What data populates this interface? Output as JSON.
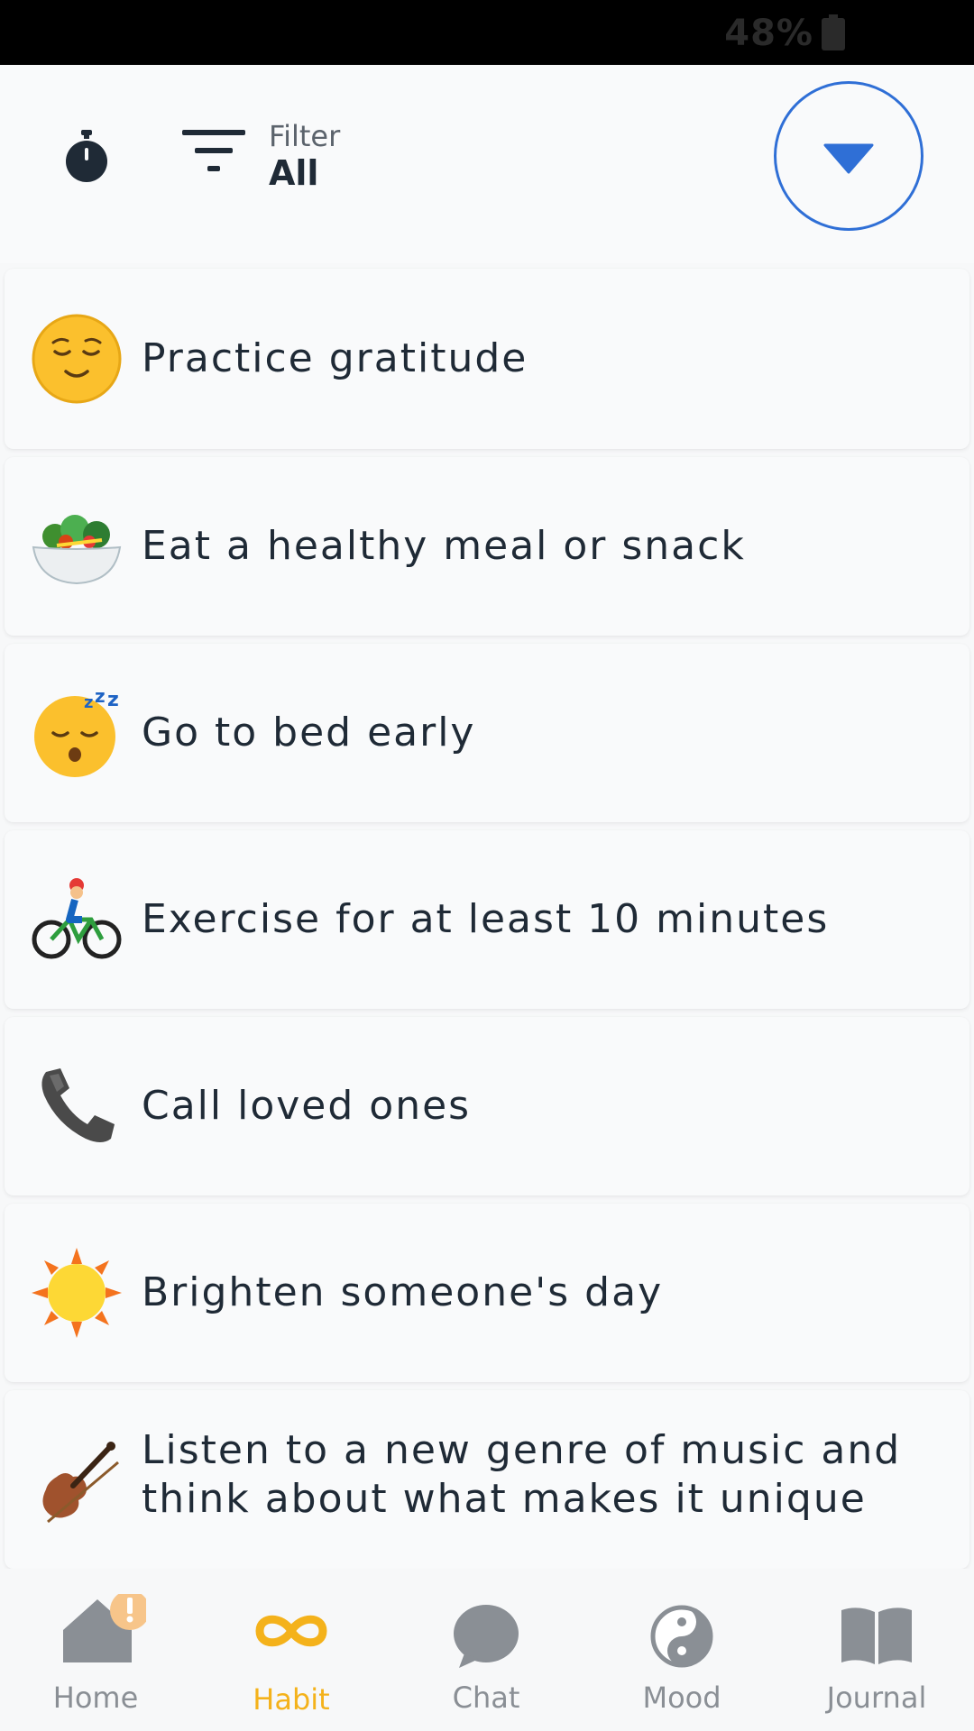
{
  "status_bar": {
    "battery": "48%"
  },
  "header": {
    "filter": {
      "label": "Filter",
      "value": "All"
    }
  },
  "habits": [
    {
      "emoji_icon": "relieved-face-icon",
      "label": "Practice gratitude"
    },
    {
      "emoji_icon": "salad-bowl-icon",
      "label": "Eat a healthy meal or snack"
    },
    {
      "emoji_icon": "sleeping-face-icon",
      "label": "Go to bed early"
    },
    {
      "emoji_icon": "person-biking-icon",
      "label": "Exercise for at least 10 minutes"
    },
    {
      "emoji_icon": "telephone-receiver-icon",
      "label": "Call loved ones"
    },
    {
      "emoji_icon": "sun-icon",
      "label": "Brighten someone's day"
    },
    {
      "emoji_icon": "violin-icon",
      "label": "Listen to a new genre of music and think about what makes it unique"
    }
  ],
  "tabs": [
    {
      "label": "Home",
      "icon": "home-icon",
      "badge": "!"
    },
    {
      "label": "Habit",
      "icon": "infinity-icon",
      "active": true
    },
    {
      "label": "Chat",
      "icon": "chat-bubble-icon"
    },
    {
      "label": "Mood",
      "icon": "yin-yang-icon"
    },
    {
      "label": "Journal",
      "icon": "open-book-icon"
    }
  ],
  "colors": {
    "accent_blue": "#2f6fd6",
    "active_tab": "#f4b21b",
    "inactive_tab": "#8a8f95",
    "badge": "#f7c58a"
  }
}
